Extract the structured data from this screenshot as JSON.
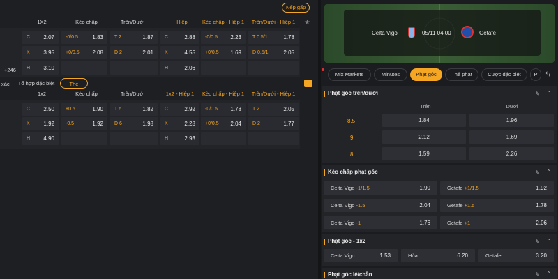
{
  "left": {
    "nep_gap": "Nếp gấp",
    "plus": "+246",
    "headers1": [
      "1X2",
      "Kèo chấp",
      "Trên/Dưới",
      "Hiệp",
      "Kèo chấp - Hiệp 1",
      "Trên/Dưới - Hiệp 1"
    ],
    "rows1": [
      {
        "k": "C",
        "v": "2.07",
        "hk": "-0/0.5",
        "hv": "1.83",
        "ok": "T 2",
        "ov": "1.87",
        "h1k": "C",
        "h1v": "2.88",
        "hh1k": "-0/0.5",
        "hh1v": "2.23",
        "oh1k": "T 0.5/1",
        "oh1v": "1.78"
      },
      {
        "k": "K",
        "v": "3.95",
        "hk": "+0/0.5",
        "hv": "2.08",
        "ok": "D 2",
        "ov": "2.01",
        "h1k": "K",
        "h1v": "4.55",
        "hh1k": "+0/0.5",
        "hh1v": "1.69",
        "oh1k": "D 0.5/1",
        "oh1v": "2.05"
      },
      {
        "k": "H",
        "v": "3.10",
        "h1k": "H",
        "h1v": "2.06"
      }
    ],
    "tabs": [
      "xác",
      "Tổ hợp đặc biệt",
      "Thẻ"
    ],
    "headers2": [
      "1x2",
      "Kèo chấp",
      "Trên/Dưới",
      "1x2 - Hiệp 1",
      "Kèo chấp - Hiệp 1",
      "Trên/Dưới - Hiệp 1"
    ],
    "rows2": [
      {
        "k": "C",
        "v": "2.50",
        "hk": "+0.5",
        "hv": "1.90",
        "ok": "T 6",
        "ov": "1.82",
        "h1k": "C",
        "h1v": "2.92",
        "hh1k": "-0/0.5",
        "hh1v": "1.78",
        "oh1k": "T 2",
        "oh1v": "2.05"
      },
      {
        "k": "K",
        "v": "1.92",
        "hk": "-0.5",
        "hv": "1.92",
        "ok": "D 6",
        "ov": "1.98",
        "h1k": "K",
        "h1v": "2.28",
        "hh1k": "+0/0.5",
        "hh1v": "2.04",
        "oh1k": "D 2",
        "oh1v": "1.77"
      },
      {
        "k": "H",
        "v": "4.90",
        "h1k": "H",
        "h1v": "2.93"
      }
    ]
  },
  "match": {
    "home": "Celta Vigo",
    "time": "05/11 04:00",
    "away": "Getafe"
  },
  "stabs": [
    "Mix Markets",
    "Minutes",
    "Phạt góc",
    "Thẻ phạt",
    "Cược đặc biệt",
    "P"
  ],
  "s1": {
    "title": "Phạt góc trên/dưới",
    "over": "Trên",
    "under": "Dưới",
    "rows": [
      {
        "l": "8.5",
        "o": "1.84",
        "u": "1.96"
      },
      {
        "l": "9",
        "o": "2.12",
        "u": "1.69"
      },
      {
        "l": "8",
        "o": "1.59",
        "u": "2.26"
      }
    ]
  },
  "s2": {
    "title": "Kèo chấp phạt góc",
    "rows": [
      {
        "a": "Celta Vigo",
        "ah": "-1/1.5",
        "av": "1.90",
        "b": "Getafe",
        "bh": "+1/1.5",
        "bv": "1.92"
      },
      {
        "a": "Celta Vigo",
        "ah": "-1.5",
        "av": "2.04",
        "b": "Getafe",
        "bh": "+1.5",
        "bv": "1.78"
      },
      {
        "a": "Celta Vigo",
        "ah": "-1",
        "av": "1.76",
        "b": "Getafe",
        "bh": "+1",
        "bv": "2.06"
      }
    ]
  },
  "s3": {
    "title": "Phạt góc - 1x2",
    "a": "Celta Vigo",
    "av": "1.53",
    "d": "Hòa",
    "dv": "6.20",
    "b": "Getafe",
    "bv": "3.20"
  },
  "s4": {
    "title": "Phạt góc lẻ/chẵn"
  }
}
